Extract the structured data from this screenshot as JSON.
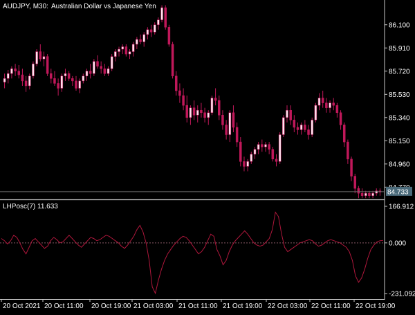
{
  "colors": {
    "background": "#000000",
    "border": "#c8c8c8",
    "text": "#ffffff",
    "bull_candle": "#ffe4ef",
    "bear_candle": "#c0185a",
    "wick": "#c0185a",
    "green_wick": "#2e8b2e",
    "oscillator_line": "#b0173c",
    "zero_line": "#8a5a66",
    "price_line": "#6e6e6e",
    "price_tag_bg": "#4a6a7a"
  },
  "header": {
    "symbol_label": "AUDJPY, M30:",
    "description": "Australian Dollar vs Japanese Yen"
  },
  "price_tag": "84.733",
  "indicator": {
    "label": "LHPosc(7) 11.633"
  },
  "chart_data": [
    {
      "type": "candlestick",
      "title": "AUDJPY, M30:  Australian Dollar vs Japanese Yen",
      "y_ticks": [
        "86.100",
        "85.910",
        "85.720",
        "85.530",
        "85.340",
        "85.150",
        "84.960",
        "84.770"
      ],
      "ylim": [
        84.67,
        86.28
      ],
      "current_price": 84.733,
      "x_tick_labels": [
        "20 Oct 2021",
        "20 Oct 11:00",
        "20 Oct 19:00",
        "21 Oct 03:00",
        "21 Oct 11:00",
        "21 Oct 19:00",
        "22 Oct 03:00",
        "22 Oct 11:00",
        "22 Oct 19:00"
      ],
      "ohlc": [
        [
          85.63,
          85.7,
          85.58,
          85.66
        ],
        [
          85.66,
          85.73,
          85.62,
          85.7
        ],
        [
          85.7,
          85.76,
          85.66,
          85.74
        ],
        [
          85.74,
          85.78,
          85.68,
          85.72
        ],
        [
          85.72,
          85.77,
          85.66,
          85.69
        ],
        [
          85.69,
          85.74,
          85.6,
          85.64
        ],
        [
          85.64,
          85.68,
          85.55,
          85.6
        ],
        [
          85.6,
          85.7,
          85.57,
          85.68
        ],
        [
          85.68,
          85.8,
          85.66,
          85.78
        ],
        [
          85.78,
          85.9,
          85.76,
          85.88
        ],
        [
          85.88,
          85.94,
          85.8,
          85.82
        ],
        [
          85.82,
          85.88,
          85.76,
          85.84
        ],
        [
          85.84,
          85.86,
          85.68,
          85.7
        ],
        [
          85.7,
          85.74,
          85.62,
          85.66
        ],
        [
          85.66,
          85.72,
          85.6,
          85.62
        ],
        [
          85.62,
          85.66,
          85.52,
          85.58
        ],
        [
          85.58,
          85.7,
          85.55,
          85.68
        ],
        [
          85.68,
          85.74,
          85.64,
          85.7
        ],
        [
          85.7,
          85.72,
          85.64,
          85.66
        ],
        [
          85.66,
          85.68,
          85.6,
          85.64
        ],
        [
          85.64,
          85.68,
          85.56,
          85.58
        ],
        [
          85.58,
          85.66,
          85.54,
          85.64
        ],
        [
          85.64,
          85.7,
          85.62,
          85.68
        ],
        [
          85.68,
          85.74,
          85.64,
          85.72
        ],
        [
          85.72,
          85.78,
          85.66,
          85.7
        ],
        [
          85.7,
          85.82,
          85.68,
          85.8
        ],
        [
          85.8,
          85.85,
          85.74,
          85.76
        ],
        [
          85.76,
          85.8,
          85.7,
          85.74
        ],
        [
          85.74,
          85.78,
          85.68,
          85.7
        ],
        [
          85.7,
          85.76,
          85.68,
          85.74
        ],
        [
          85.74,
          85.86,
          85.72,
          85.84
        ],
        [
          85.84,
          85.9,
          85.8,
          85.88
        ],
        [
          85.88,
          85.92,
          85.84,
          85.9
        ],
        [
          85.9,
          85.94,
          85.86,
          85.92
        ],
        [
          85.92,
          85.94,
          85.84,
          85.86
        ],
        [
          85.86,
          85.9,
          85.82,
          85.88
        ],
        [
          85.88,
          85.96,
          85.84,
          85.94
        ],
        [
          85.94,
          86.0,
          85.9,
          85.98
        ],
        [
          85.98,
          86.02,
          85.94,
          85.96
        ],
        [
          85.96,
          86.04,
          85.92,
          86.02
        ],
        [
          86.02,
          86.08,
          85.98,
          86.06
        ],
        [
          86.06,
          86.1,
          86.0,
          86.04
        ],
        [
          86.04,
          86.12,
          86.02,
          86.1
        ],
        [
          86.1,
          86.16,
          86.06,
          86.14
        ],
        [
          86.14,
          86.26,
          86.12,
          86.24
        ],
        [
          86.24,
          86.26,
          86.06,
          86.08
        ],
        [
          86.08,
          86.1,
          85.92,
          85.94
        ],
        [
          85.94,
          85.96,
          85.66,
          85.68
        ],
        [
          85.68,
          85.72,
          85.52,
          85.56
        ],
        [
          85.56,
          85.62,
          85.46,
          85.52
        ],
        [
          85.52,
          85.58,
          85.4,
          85.44
        ],
        [
          85.44,
          85.52,
          85.3,
          85.34
        ],
        [
          85.34,
          85.44,
          85.28,
          85.42
        ],
        [
          85.42,
          85.48,
          85.32,
          85.36
        ],
        [
          85.36,
          85.44,
          85.3,
          85.4
        ],
        [
          85.4,
          85.46,
          85.34,
          85.38
        ],
        [
          85.38,
          85.42,
          85.3,
          85.34
        ],
        [
          85.34,
          85.4,
          85.28,
          85.38
        ],
        [
          85.38,
          85.52,
          85.36,
          85.5
        ],
        [
          85.5,
          85.58,
          85.44,
          85.48
        ],
        [
          85.48,
          85.52,
          85.32,
          85.36
        ],
        [
          85.36,
          85.4,
          85.24,
          85.28
        ],
        [
          85.28,
          85.32,
          85.16,
          85.2
        ],
        [
          85.2,
          85.4,
          85.14,
          85.38
        ],
        [
          85.38,
          85.44,
          85.22,
          85.26
        ],
        [
          85.26,
          85.3,
          85.1,
          85.14
        ],
        [
          85.14,
          85.18,
          84.94,
          84.98
        ],
        [
          84.98,
          85.02,
          84.9,
          84.94
        ],
        [
          84.94,
          85.0,
          84.9,
          84.98
        ],
        [
          84.98,
          85.06,
          84.96,
          85.04
        ],
        [
          85.04,
          85.1,
          85.0,
          85.08
        ],
        [
          85.08,
          85.14,
          85.04,
          85.12
        ],
        [
          85.12,
          85.16,
          85.06,
          85.1
        ],
        [
          85.1,
          85.14,
          85.06,
          85.12
        ],
        [
          85.12,
          85.14,
          85.04,
          85.08
        ],
        [
          85.08,
          85.1,
          84.98,
          85.0
        ],
        [
          85.0,
          85.04,
          84.94,
          84.98
        ],
        [
          84.98,
          85.22,
          84.96,
          85.2
        ],
        [
          85.2,
          85.36,
          85.18,
          85.34
        ],
        [
          85.34,
          85.44,
          85.3,
          85.4
        ],
        [
          85.4,
          85.44,
          85.28,
          85.32
        ],
        [
          85.32,
          85.36,
          85.22,
          85.26
        ],
        [
          85.26,
          85.3,
          85.2,
          85.24
        ],
        [
          85.24,
          85.3,
          85.2,
          85.28
        ],
        [
          85.28,
          85.32,
          85.22,
          85.24
        ],
        [
          85.24,
          85.28,
          85.16,
          85.2
        ],
        [
          85.2,
          85.34,
          85.18,
          85.32
        ],
        [
          85.32,
          85.46,
          85.3,
          85.44
        ],
        [
          85.44,
          85.54,
          85.4,
          85.5
        ],
        [
          85.5,
          85.56,
          85.42,
          85.46
        ],
        [
          85.46,
          85.5,
          85.38,
          85.42
        ],
        [
          85.42,
          85.48,
          85.38,
          85.46
        ],
        [
          85.46,
          85.5,
          85.4,
          85.44
        ],
        [
          85.44,
          85.46,
          85.34,
          85.38
        ],
        [
          85.38,
          85.4,
          85.24,
          85.28
        ],
        [
          85.28,
          85.3,
          85.1,
          85.14
        ],
        [
          85.14,
          85.16,
          84.96,
          85.0
        ],
        [
          85.0,
          85.02,
          84.82,
          84.86
        ],
        [
          84.86,
          84.88,
          84.72,
          84.76
        ],
        [
          84.76,
          84.78,
          84.68,
          84.72
        ],
        [
          84.72,
          84.76,
          84.68,
          84.7
        ],
        [
          84.7,
          84.74,
          84.68,
          84.72
        ],
        [
          84.72,
          84.74,
          84.68,
          84.7
        ],
        [
          84.7,
          84.74,
          84.68,
          84.72
        ],
        [
          84.72,
          84.76,
          84.7,
          84.74
        ],
        [
          84.74,
          84.76,
          84.7,
          84.73
        ]
      ]
    },
    {
      "type": "line",
      "title": "LHPosc(7) 11.633",
      "series_label": "LHPosc(7)",
      "current_value": 11.633,
      "y_ticks": [
        "166.912",
        "0.000",
        "-231.092"
      ],
      "ylim": [
        -231.092,
        166.912
      ],
      "values": [
        20,
        10,
        -5,
        10,
        35,
        25,
        0,
        -30,
        -50,
        -20,
        10,
        20,
        5,
        -10,
        -25,
        -15,
        10,
        25,
        15,
        0,
        5,
        20,
        35,
        20,
        5,
        -10,
        -20,
        -5,
        10,
        25,
        20,
        10,
        15,
        25,
        35,
        30,
        20,
        10,
        0,
        -15,
        -25,
        -10,
        10,
        30,
        60,
        80,
        50,
        0,
        -80,
        -200,
        -230,
        -170,
        -120,
        -80,
        -50,
        -30,
        -10,
        5,
        20,
        30,
        25,
        10,
        -10,
        -30,
        -50,
        -40,
        -20,
        10,
        40,
        30,
        -30,
        -60,
        -100,
        -80,
        -40,
        -10,
        10,
        25,
        40,
        55,
        40,
        20,
        0,
        -10,
        -15,
        -10,
        5,
        20,
        60,
        140,
        120,
        40,
        -20,
        -40,
        -30,
        -20,
        -10,
        0,
        5,
        10,
        15,
        10,
        -5,
        -15,
        -10,
        0,
        10,
        15,
        10,
        5,
        0,
        -10,
        -20,
        -40,
        -80,
        -150,
        -180,
        -160,
        -120,
        -70,
        -30,
        -10,
        5,
        10,
        11.633
      ]
    }
  ]
}
